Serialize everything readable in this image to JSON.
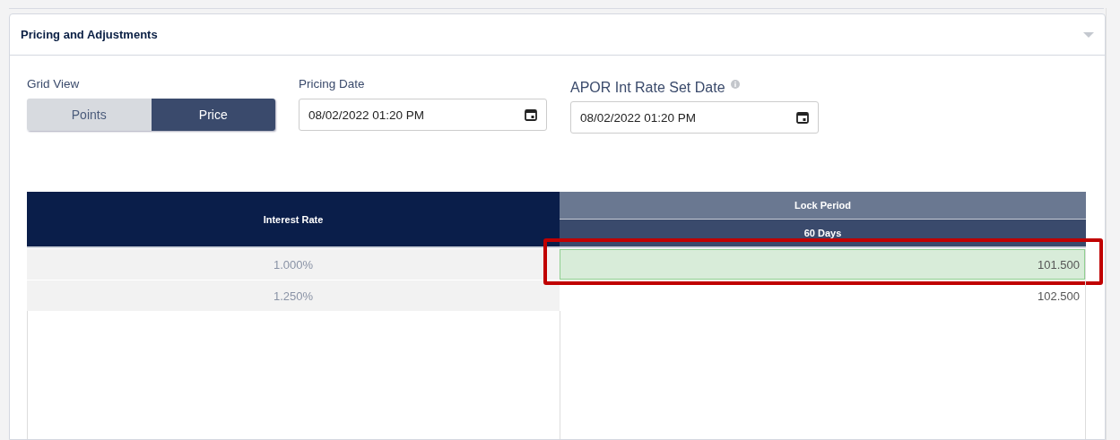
{
  "panel": {
    "title": "Pricing and Adjustments",
    "expanded": true
  },
  "grid_view": {
    "label": "Grid View",
    "options": [
      {
        "label": "Points",
        "selected": false
      },
      {
        "label": "Price",
        "selected": true
      }
    ]
  },
  "pricing_date": {
    "label": "Pricing Date",
    "value": "08/02/2022 01:20 PM"
  },
  "apor_date": {
    "label": "APOR Int Rate Set Date",
    "value": "08/02/2022 01:20 PM"
  },
  "table": {
    "rate_header": "Interest Rate",
    "group_header": "Lock Period",
    "period_header": "60 Days",
    "rows": [
      {
        "rate": "1.000%",
        "price": "101.500",
        "selected": true,
        "outlined": true
      },
      {
        "rate": "1.250%",
        "price": "102.500",
        "selected": false,
        "outlined": false
      }
    ]
  }
}
